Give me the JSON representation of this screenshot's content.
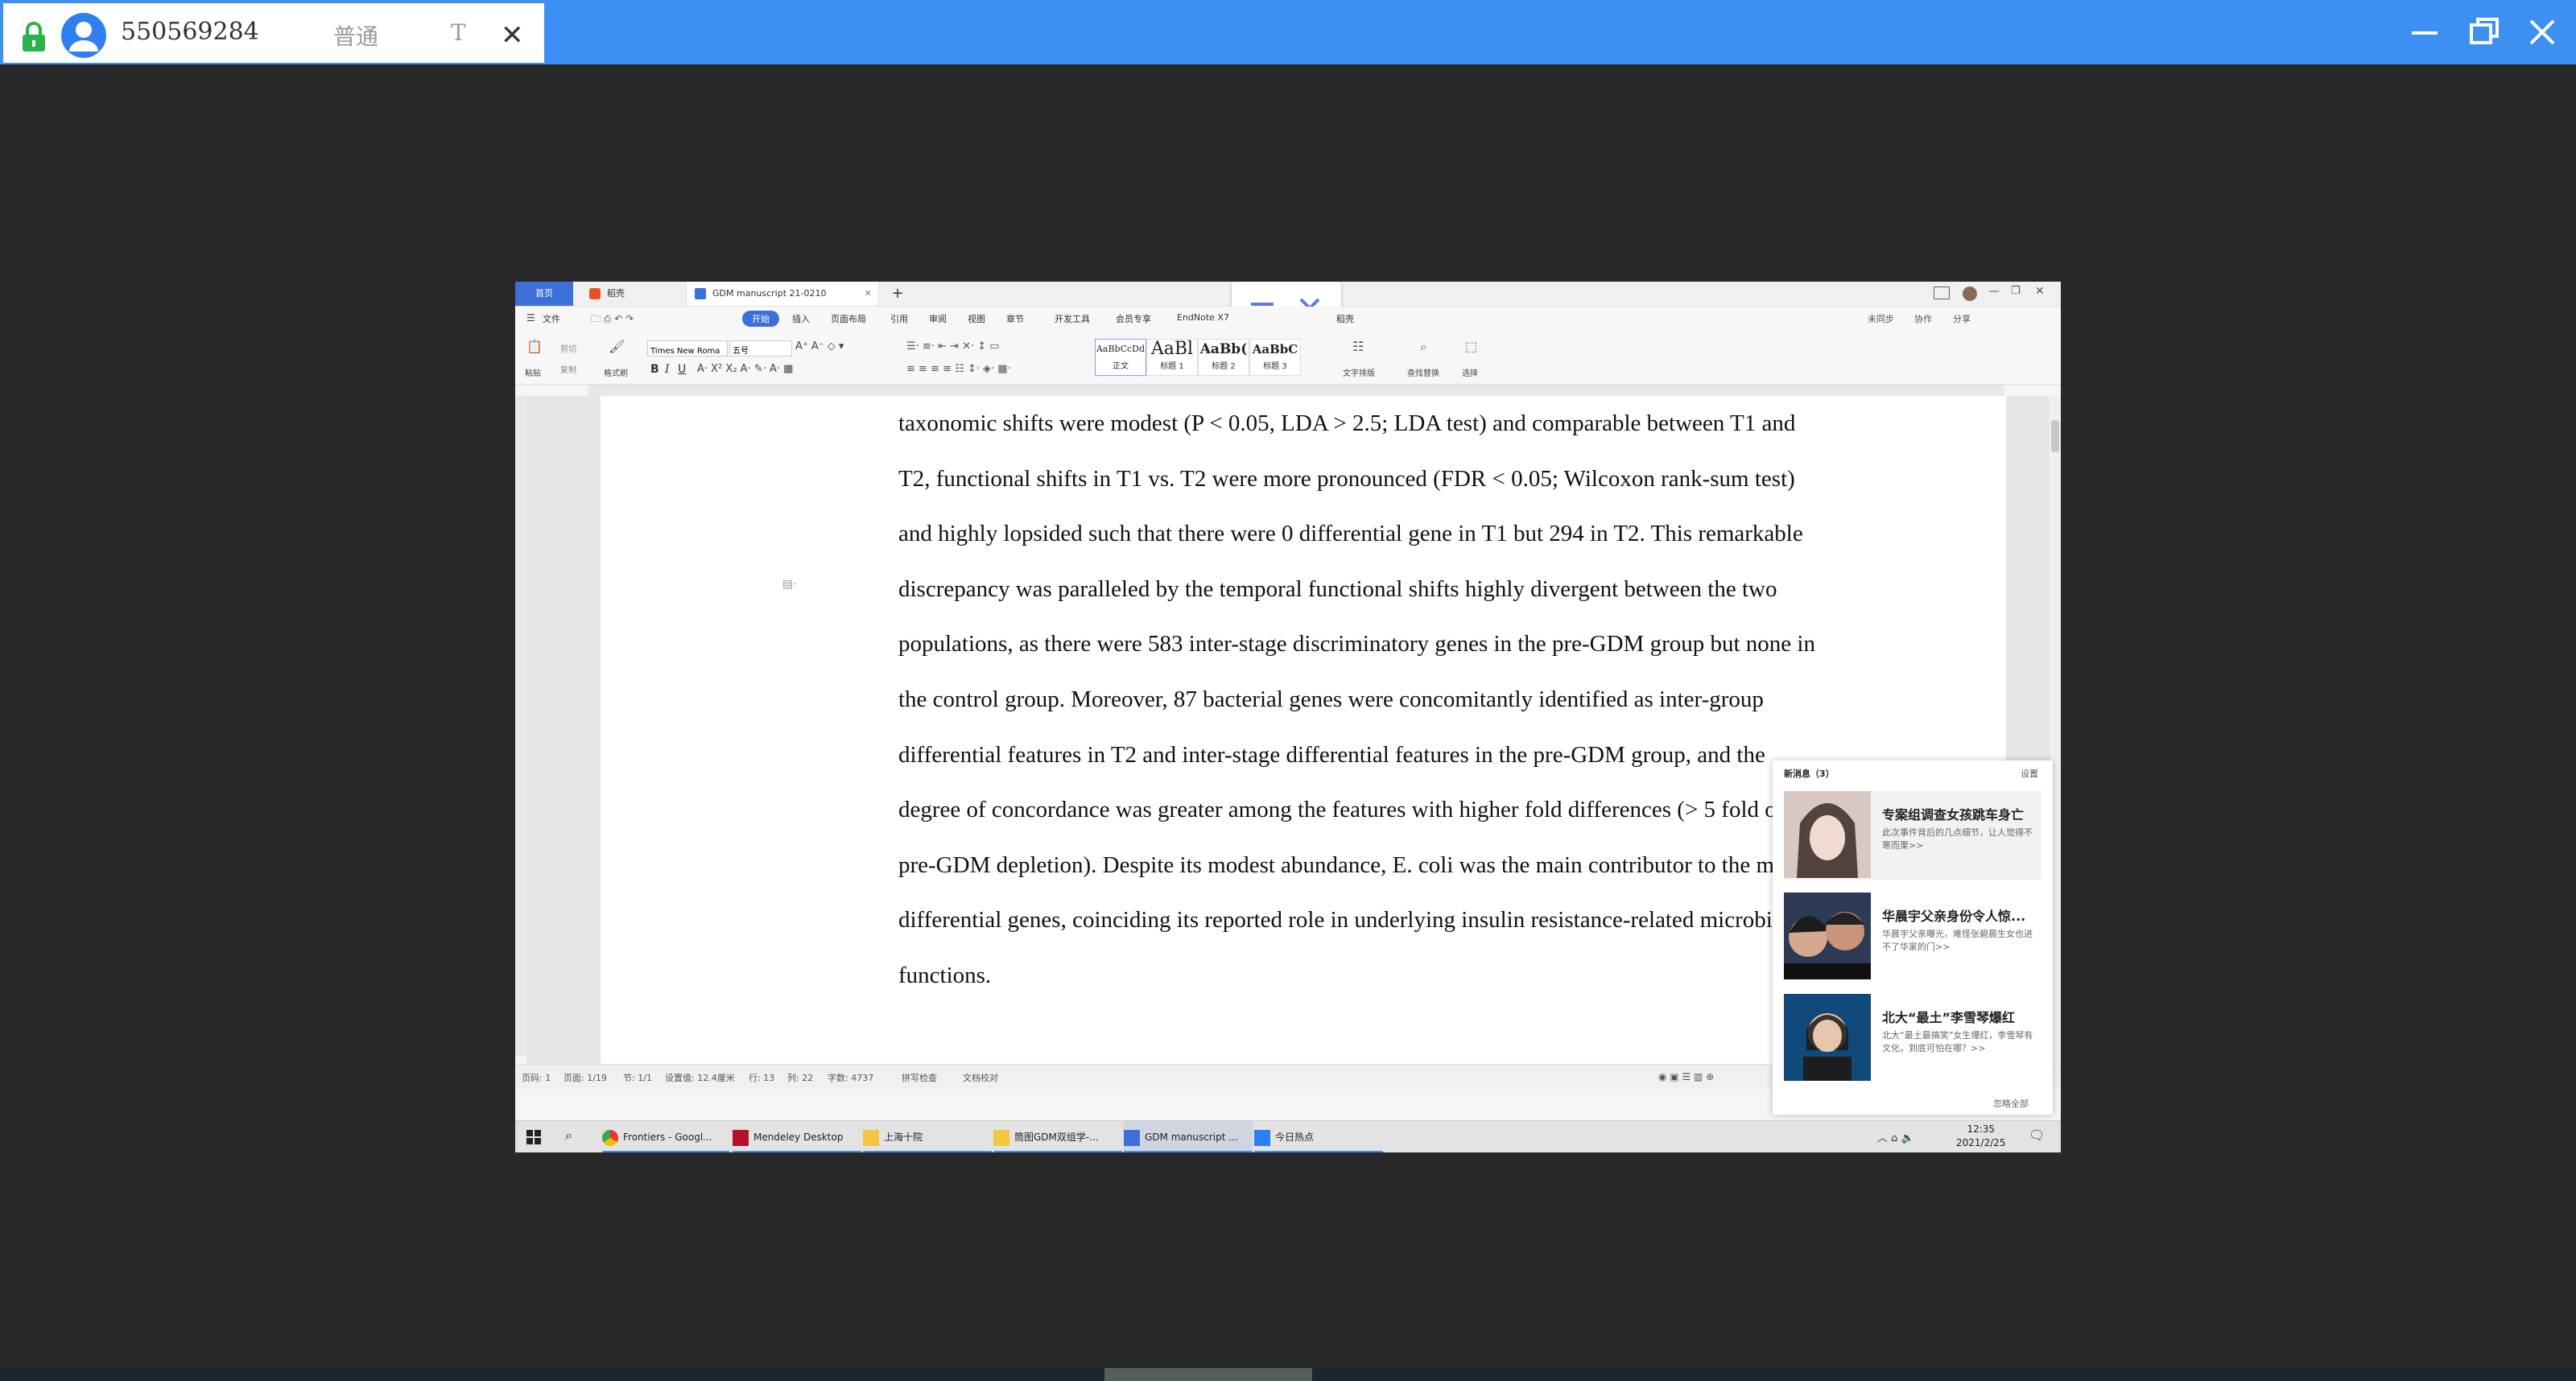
{
  "viewer": {
    "session_id": "550569284",
    "mode": "普通",
    "t_label": "T",
    "close_glyph": "✕"
  },
  "wps": {
    "tabs": {
      "home": "首页",
      "docer": "稻壳",
      "document": "GDM manuscript 21-0210",
      "add": "+"
    },
    "menu": [
      "文件",
      "开始",
      "插入",
      "页面布局",
      "引用",
      "审阅",
      "视图",
      "章节",
      "开发工具",
      "会员专享",
      "EndNote X7",
      "稻壳"
    ],
    "menu_right": [
      "未同步",
      "协作",
      "分享"
    ],
    "ribbon": {
      "paste": "粘贴",
      "cut": "剪切",
      "copy": "复制",
      "format_painter": "格式刷",
      "font_name": "Times New Roma",
      "font_size": "五号",
      "styles": [
        {
          "sample": "AaBbCcDd",
          "name": "正文"
        },
        {
          "sample": "AaBl",
          "name": "标题 1"
        },
        {
          "sample": "AaBb(",
          "name": "标题 2"
        },
        {
          "sample": "AaBbC",
          "name": "标题 3"
        }
      ],
      "text_layout": "文字排版",
      "find_replace": "查找替换",
      "select": "选择"
    }
  },
  "document": {
    "lines": [
      "taxonomic shifts were modest (P < 0.05, LDA > 2.5; LDA test) and comparable between T1 and",
      "T2, functional shifts in T1 vs. T2 were more pronounced (FDR < 0.05; Wilcoxon rank-sum test)",
      "and highly lopsided such that there were 0 differential gene in T1 but 294 in T2. This remarkable",
      "discrepancy was paralleled by the temporal functional shifts highly divergent between the two",
      "populations, as there were 583 inter-stage discriminatory genes in the pre-GDM group but none in",
      "the control group. Moreover, 87 bacterial genes were concomitantly identified as inter-group",
      "differential features in T2 and inter-stage differential features in the pre-GDM group, and the",
      "degree of concordance was greater among the features with higher fold differences (> 5 fold of",
      "pre-GDM depletion). Despite its modest abundance, E. coli was the main contributor to the most",
      "differential genes, coinciding its reported role in underlying insulin resistance-related microbial",
      "functions."
    ]
  },
  "status": {
    "page": "页码: 1",
    "pages": "页面: 1/19",
    "section": "节: 1/1",
    "setting": "设置值: 12.4厘米",
    "row": "行: 13",
    "col": "列: 22",
    "words": "字数: 4737",
    "spell": "拼写检查",
    "proof": "文档校对"
  },
  "news": {
    "header": "新消息（3）",
    "settings": "设置",
    "items": [
      {
        "title": "专案组调查女孩跳车身亡",
        "desc": "此次事件背后的几点细节，让人觉得不寒而栗>>"
      },
      {
        "title": "华晨宇父亲身份令人惊...",
        "desc": "华晨宇父亲曝光，难怪张碧晨生女也进不了华家的门>>"
      },
      {
        "title": "北大“最土”李雪琴爆红",
        "desc": "北大“最土最搞笑”女生爆红，李雪琴有文化，到底可怕在哪？>>"
      }
    ],
    "ignore_all": "忽略全部"
  },
  "taskbar": {
    "items": [
      "Frontiers - Googl...",
      "Mendeley Desktop",
      "上海十院",
      "筒图GDM双组学-...",
      "GDM manuscript ...",
      "今日热点"
    ],
    "time": "12:35",
    "date": "2021/2/25"
  },
  "colors": {
    "viewer_bar": "#3d90f2",
    "wps_accent": "#3d6fd8",
    "background": "#282828"
  }
}
